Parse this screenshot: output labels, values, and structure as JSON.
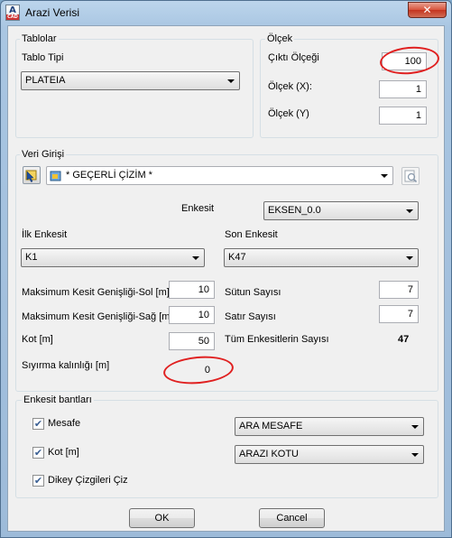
{
  "window": {
    "title": "Arazi Verisi",
    "close_glyph": "✕",
    "app_icon_letter": "A",
    "app_icon_sub": "CAD"
  },
  "tablolar": {
    "group_label": "Tablolar",
    "tablo_tipi_label": "Tablo Tipi",
    "tablo_tipi_value": "PLATEIA"
  },
  "olcek": {
    "group_label": "Ölçek",
    "cikti_label": "Çıktı Ölçeği",
    "cikti_value": "100",
    "x_label": "Ölçek (X):",
    "x_value": "1",
    "y_label": "Ölçek (Y)",
    "y_value": "1"
  },
  "veri_girisi": {
    "group_label": "Veri Girişi",
    "source_value": "* GEÇERLİ ÇİZİM *",
    "enkesit_label": "Enkesit",
    "enkesit_value": "EKSEN_0.0",
    "ilk_label": "İlk Enkesit",
    "ilk_value": "K1",
    "son_label": "Son Enkesit",
    "son_value": "K47",
    "max_sol_label": "Maksimum Kesit Genişliği-Sol [m]",
    "max_sol_value": "10",
    "max_sag_label": "Maksimum Kesit Genişliği-Sağ [m]",
    "max_sag_value": "10",
    "kot_label": "Kot [m]",
    "kot_value": "50",
    "siyirma_label": "Sıyırma kalınlığı [m]",
    "siyirma_value": "0",
    "sutun_label": "Sütun Sayısı",
    "sutun_value": "7",
    "satir_label": "Satır Sayısı",
    "satir_value": "7",
    "toplam_label": "Tüm Enkesitlerin Sayısı",
    "toplam_value": "47"
  },
  "bantlar": {
    "group_label": "Enkesit bantları",
    "checkmark": "✔",
    "mesafe_label": "Mesafe",
    "mesafe_value": "ARA MESAFE",
    "kot_label": "Kot [m]",
    "kot_value": "ARAZI KOTU",
    "dikey_label": "Dikey Çizgileri Çiz"
  },
  "buttons": {
    "ok": "OK",
    "cancel": "Cancel"
  },
  "colors": {
    "highlight_circle": "#e02020",
    "titlebar": "#a9c6e2",
    "close": "#c3341f"
  }
}
